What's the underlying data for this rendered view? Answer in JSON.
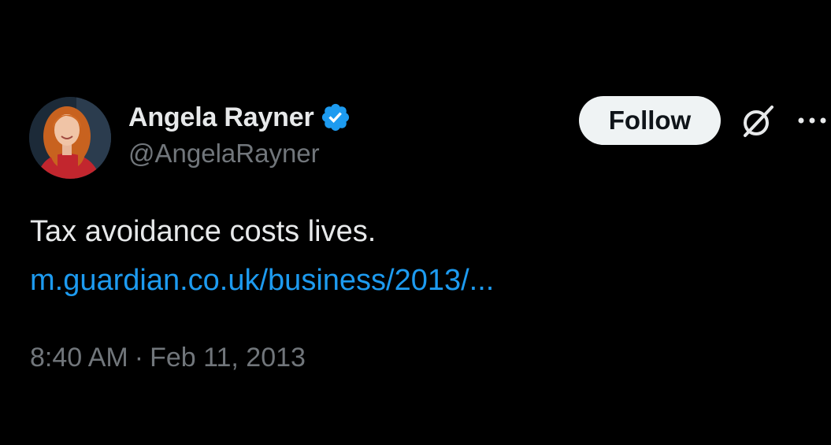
{
  "author": {
    "display_name": "Angela Rayner",
    "handle": "@AngelaRayner",
    "verified": true,
    "verified_color": "#1d9bf0"
  },
  "actions": {
    "follow_label": "Follow",
    "grok_icon": "grok-icon",
    "more_icon": "more-icon"
  },
  "tweet": {
    "text": "Tax avoidance costs lives.",
    "link": "m.guardian.co.uk/business/2013/...",
    "time": "8:40 AM",
    "separator": "·",
    "date": "Feb 11, 2013"
  },
  "colors": {
    "background": "#000000",
    "primary_text": "#e7e9ea",
    "secondary_text": "#71767b",
    "link": "#1d9bf0",
    "follow_bg": "#eff3f4"
  }
}
